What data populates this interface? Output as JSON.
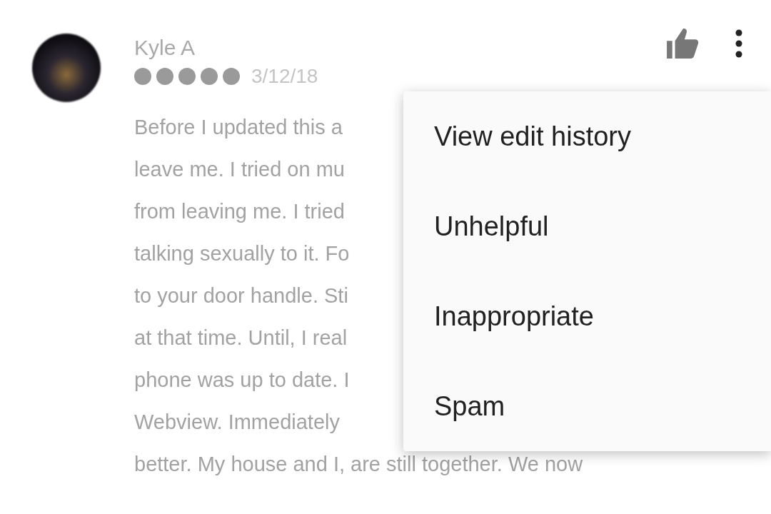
{
  "review": {
    "author": "Kyle A",
    "stars": 5,
    "date": "3/12/18",
    "lines": [
      "Before I updated this a",
      "leave me. I tried on mu",
      "from leaving me. I tried",
      "talking sexually to it. Fo",
      "to your door handle. Sti",
      "at that time. Until, I real",
      "phone was up to date. I",
      "Webview. Immediately",
      "better. My house and I, are still together. We now"
    ]
  },
  "menu": {
    "items": [
      {
        "label": "View edit history"
      },
      {
        "label": "Unhelpful"
      },
      {
        "label": "Inappropriate"
      },
      {
        "label": "Spam"
      }
    ]
  }
}
